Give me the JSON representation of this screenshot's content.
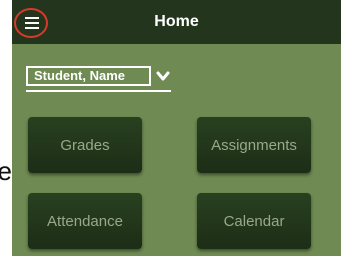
{
  "stray_text": "e",
  "header": {
    "title": "Home"
  },
  "student_selector": {
    "value": "Student, Name"
  },
  "tiles": [
    {
      "label": "Grades"
    },
    {
      "label": "Assignments"
    },
    {
      "label": "Attendance"
    },
    {
      "label": "Calendar"
    }
  ],
  "colors": {
    "header_bg": "#23351c",
    "page_bg": "#6f8a52",
    "tile_bg": "#23371b",
    "tile_text": "#9aa88a",
    "highlight_circle": "#d63a2c"
  },
  "icons": {
    "menu": "hamburger-menu-icon",
    "dropdown": "chevron-down-icon"
  }
}
